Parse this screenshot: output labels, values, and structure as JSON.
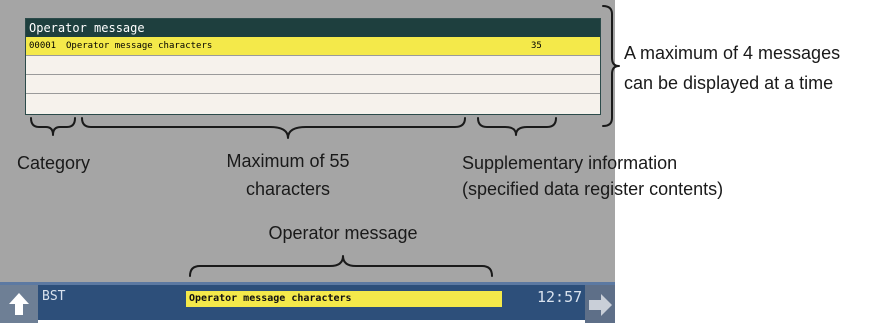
{
  "panel": {
    "title": "Operator message",
    "rows": [
      {
        "code": "00001",
        "text": "Operator message characters",
        "supp": "35"
      },
      {
        "code": "",
        "text": "",
        "supp": ""
      },
      {
        "code": "",
        "text": "",
        "supp": ""
      },
      {
        "code": "",
        "text": "",
        "supp": ""
      }
    ]
  },
  "annotations": {
    "max_messages_line1": "A maximum of 4 messages",
    "max_messages_line2": "can be displayed at a time",
    "category": "Category",
    "max_chars_line1": "Maximum of 55",
    "max_chars_line2": "characters",
    "supp_line1": "Supplementary information",
    "supp_line2": "(specified data register contents)",
    "operator_message": "Operator message"
  },
  "statusbar": {
    "mode": "BST",
    "message": "Operator message characters",
    "time": "12:57",
    "left_icon": "up-arrow-icon",
    "right_icon": "right-arrow-icon"
  },
  "colors": {
    "screen_bg": "#a5a5a5",
    "title_bg": "#1e3f3e",
    "highlight": "#f4e94a",
    "statusbar_bg": "#2d4f7a"
  }
}
